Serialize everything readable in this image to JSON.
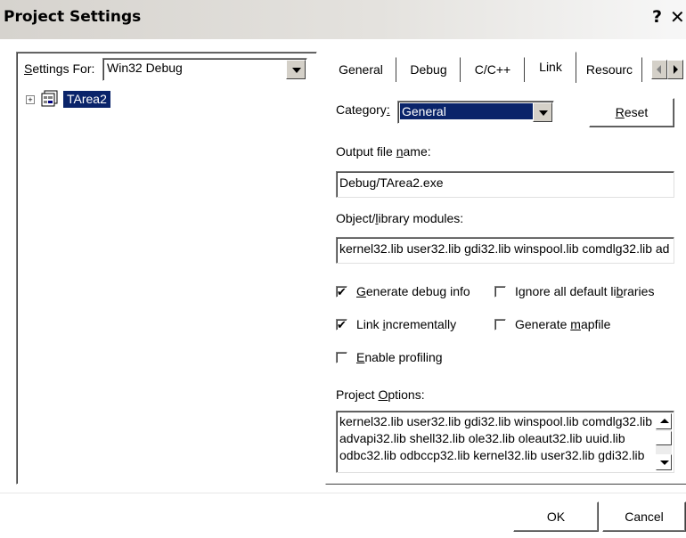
{
  "window": {
    "title": "Project Settings",
    "help_glyph": "?",
    "close_glyph": "✕"
  },
  "left": {
    "settings_for_label": "Settings For:",
    "settings_for_value": "Win32 Debug",
    "tree": {
      "expander": "+",
      "label": "TArea2",
      "icon": "project-workspace-icon"
    }
  },
  "tabs": [
    {
      "label": "General",
      "active": false
    },
    {
      "label": "Debug",
      "active": false
    },
    {
      "label": "C/C++",
      "active": false
    },
    {
      "label": "Link",
      "active": true
    },
    {
      "label": "Resourc",
      "active": false
    }
  ],
  "link": {
    "category_label": "Category:",
    "category_value": "General",
    "reset_label": "Reset",
    "output_label": "Output file name:",
    "output_value": "Debug/TArea2.exe",
    "objlib_label": "Object/library modules:",
    "objlib_value": "kernel32.lib user32.lib gdi32.lib winspool.lib comdlg32.lib ad",
    "options": {
      "generate_debug": {
        "label": "Generate debug info",
        "checked": true
      },
      "ignore_defaults": {
        "label": "Ignore all default libraries",
        "checked": false
      },
      "link_incremental": {
        "label": "Link incrementally",
        "checked": true
      },
      "generate_mapfile": {
        "label": "Generate mapfile",
        "checked": false
      },
      "enable_profiling": {
        "label": "Enable profiling",
        "checked": false
      }
    },
    "project_options_label": "Project Options:",
    "project_options_lines": [
      "kernel32.lib user32.lib gdi32.lib winspool.lib comdlg32.lib",
      "advapi32.lib shell32.lib ole32.lib oleaut32.lib uuid.lib",
      "odbc32.lib odbccp32.lib kernel32.lib user32.lib gdi32.lib"
    ]
  },
  "footer": {
    "ok_label": "OK",
    "cancel_label": "Cancel"
  },
  "check_glyph": "✔"
}
